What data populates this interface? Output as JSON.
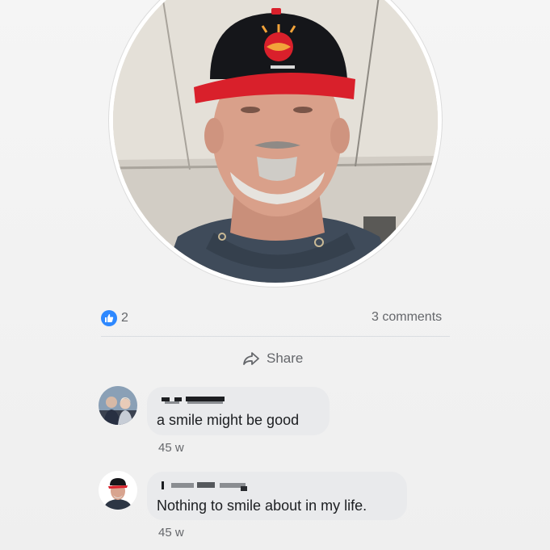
{
  "post": {
    "reactions": {
      "icon": "like-icon",
      "count": "2",
      "color": "#2d88ff"
    },
    "comments_label": "3 comments",
    "share_label": "Share"
  },
  "comments": [
    {
      "author": "J…y Young",
      "text": "a smile might be good",
      "time": "45 w"
    },
    {
      "author": "",
      "text": "Nothing to smile about in my life.",
      "time": "45 w"
    }
  ]
}
